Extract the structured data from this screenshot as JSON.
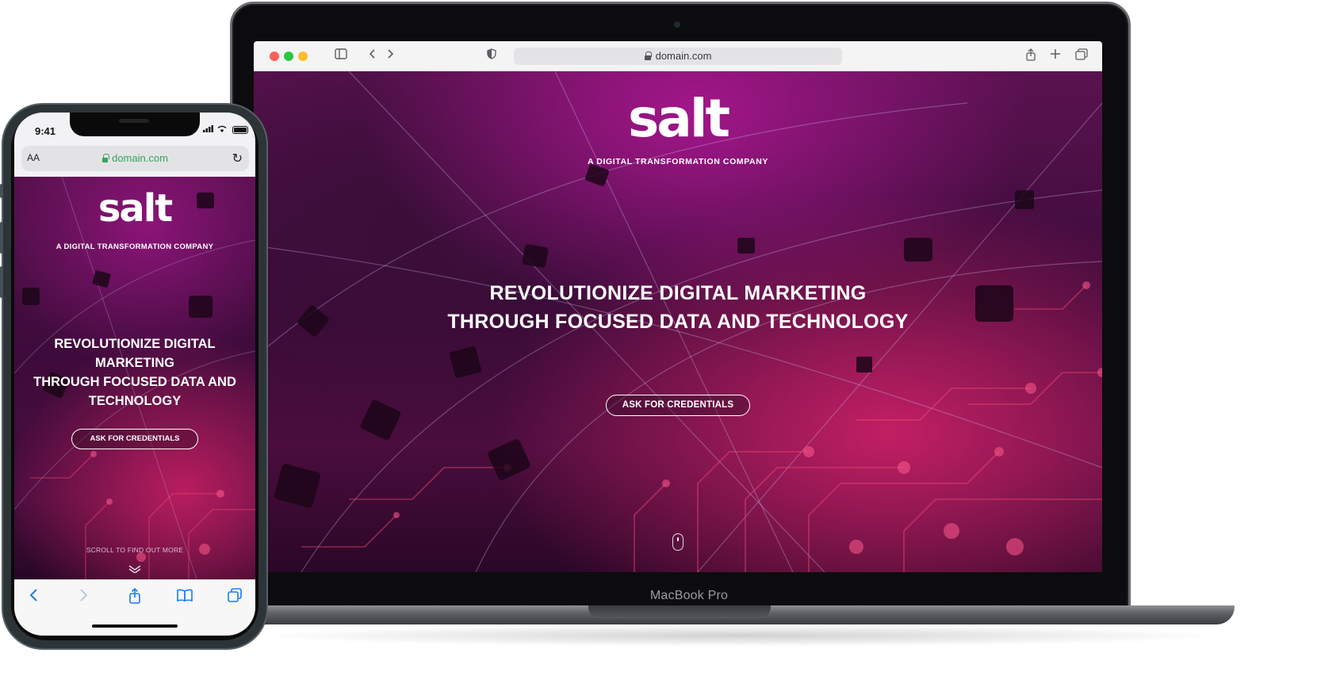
{
  "laptop": {
    "model_label": "MacBook Pro",
    "browser": {
      "url": "domain.com",
      "icons": [
        "sidebar-icon",
        "back-icon",
        "forward-icon",
        "privacy-shield-icon",
        "share-icon",
        "new-tab-icon",
        "tabs-overview-icon"
      ]
    },
    "site": {
      "logo": "salt",
      "tagline": "A DIGITAL TRANSFORMATION COMPANY",
      "headline_line1": "REVOLUTIONIZE DIGITAL MARKETING",
      "headline_line2": "THROUGH FOCUSED DATA AND TECHNOLOGY",
      "cta_label": "ASK FOR CREDENTIALS"
    }
  },
  "phone": {
    "status_time": "9:41",
    "browser": {
      "text_size_label": "AA",
      "url": "domain.com"
    },
    "site": {
      "logo": "salt",
      "tagline": "A DIGITAL TRANSFORMATION COMPANY",
      "headline_line1": "REVOLUTIONIZE DIGITAL",
      "headline_line2": "MARKETING",
      "headline_line3": "THROUGH FOCUSED DATA AND",
      "headline_line4": "TECHNOLOGY",
      "cta_label": "ASK FOR CREDENTIALS",
      "scroll_hint": "SCROLL TO FIND OUT MORE"
    },
    "bottom_bar_icons": [
      "back-icon",
      "forward-icon",
      "share-icon",
      "bookmarks-icon",
      "tabs-icon"
    ]
  },
  "colors": {
    "accent_magenta": "#a3168a",
    "accent_pink": "#c21f63",
    "ios_blue": "#1a7cf5",
    "secure_green": "#36a35a"
  }
}
